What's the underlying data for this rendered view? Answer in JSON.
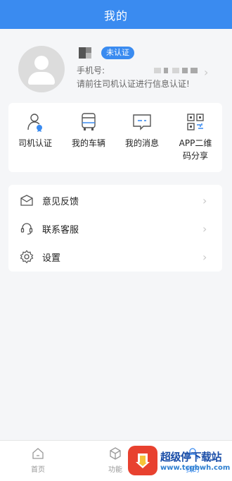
{
  "header": {
    "title": "我的"
  },
  "profile": {
    "badge": "未认证",
    "phone_label": "手机号:",
    "notice": "请前往司机认证进行信息认证!"
  },
  "quick_actions": [
    {
      "label": "司机认证",
      "icon": "driver-certify-icon"
    },
    {
      "label": "我的车辆",
      "icon": "truck-icon"
    },
    {
      "label": "我的消息",
      "icon": "message-icon"
    },
    {
      "label": "APP二维\n码分享",
      "icon": "qrcode-icon"
    }
  ],
  "menu": [
    {
      "label": "意见反馈",
      "icon": "feedback-icon"
    },
    {
      "label": "联系客服",
      "icon": "headset-icon"
    },
    {
      "label": "设置",
      "icon": "settings-icon"
    }
  ],
  "tabbar": [
    {
      "label": "首页",
      "icon": "home-icon"
    },
    {
      "label": "功能",
      "icon": "cube-icon"
    },
    {
      "label": "我的",
      "icon": "user-icon"
    }
  ],
  "watermark": {
    "title": "超级停下载站",
    "url": "www.tcgbwh.com"
  },
  "colors": {
    "primary": "#3a8bf0",
    "background": "#f5f6f8",
    "card": "#ffffff"
  }
}
